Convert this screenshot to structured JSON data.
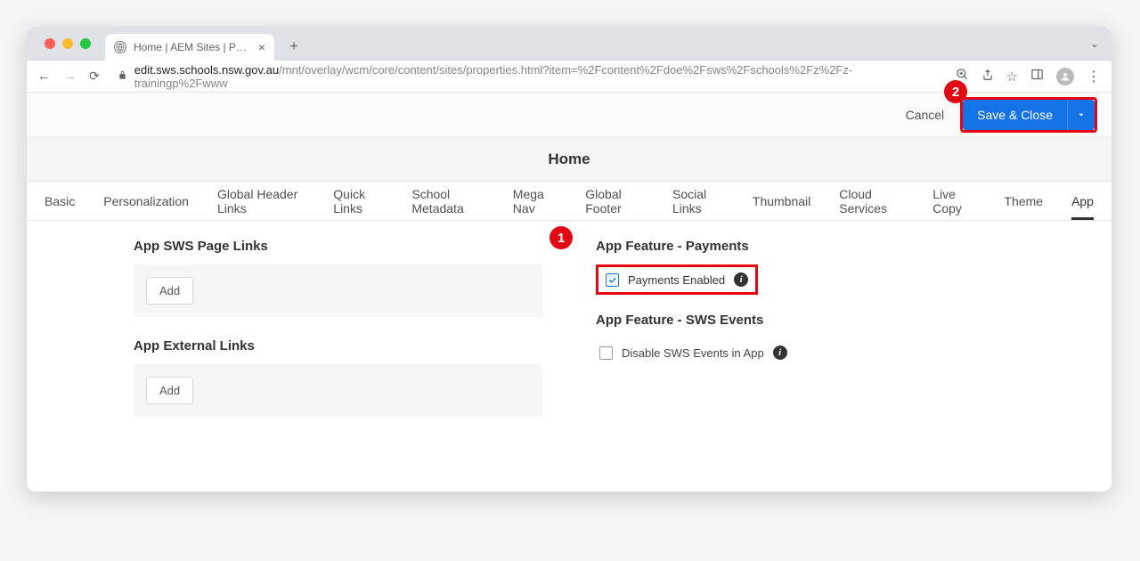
{
  "browser": {
    "tabTitle": "Home | AEM Sites | Page Prope",
    "urlDomain": "edit.sws.schools.nsw.gov.au",
    "urlPath": "/mnt/overlay/wcm/core/content/sites/properties.html?item=%2Fcontent%2Fdoe%2Fsws%2Fschools%2Fz%2Fz-trainingp%2Fwww"
  },
  "actions": {
    "cancel": "Cancel",
    "saveClose": "Save & Close"
  },
  "page": {
    "title": "Home"
  },
  "tabs": [
    {
      "label": "Basic"
    },
    {
      "label": "Personalization"
    },
    {
      "label": "Global Header Links"
    },
    {
      "label": "Quick Links"
    },
    {
      "label": "School Metadata"
    },
    {
      "label": "Mega Nav"
    },
    {
      "label": "Global Footer"
    },
    {
      "label": "Social Links"
    },
    {
      "label": "Thumbnail"
    },
    {
      "label": "Cloud Services"
    },
    {
      "label": "Live Copy"
    },
    {
      "label": "Theme"
    },
    {
      "label": "App",
      "active": true
    }
  ],
  "left": {
    "pageLinksTitle": "App SWS Page Links",
    "pageLinksAdd": "Add",
    "externalLinksTitle": "App External Links",
    "externalLinksAdd": "Add"
  },
  "right": {
    "paymentsTitle": "App Feature - Payments",
    "paymentsLabel": "Payments Enabled",
    "paymentsChecked": true,
    "eventsTitle": "App Feature - SWS Events",
    "eventsLabel": "Disable SWS Events in App",
    "eventsChecked": false
  },
  "annotations": {
    "one": "1",
    "two": "2"
  }
}
